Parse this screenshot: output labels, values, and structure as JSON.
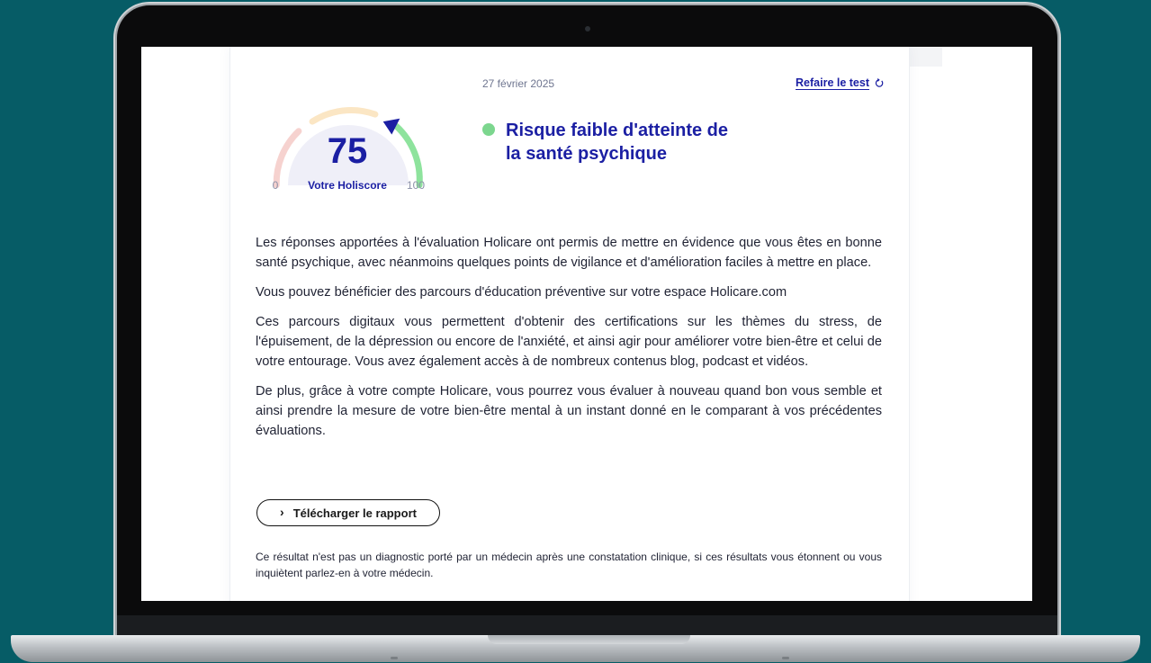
{
  "report": {
    "date": "27 février 2025",
    "retake_label": "Refaire le test",
    "score": "75",
    "score_label": "Votre Holiscore",
    "scale_min": "0",
    "scale_max": "100",
    "score_fraction": 0.75,
    "risk_title": "Risque faible d'atteinte de la santé psychique",
    "paragraphs": [
      "Les réponses apportées à l'évaluation Holicare ont permis de mettre en évidence que vous êtes en bonne santé psychique, avec néanmoins quelques points de vigilance et d'amélioration faciles à mettre en place.",
      "Vous pouvez bénéficier des parcours d'éducation préventive sur votre espace Holicare.com",
      "Ces parcours digitaux vous permettent d'obtenir des certifications sur les thèmes du stress, de l'épuisement, de la dépression ou encore de l'anxiété, et ainsi agir pour améliorer votre bien-être et celui de votre entourage. Vous avez également accès à de nombreux contenus blog, podcast et vidéos.",
      "De plus, grâce à votre compte Holicare, vous pourrez vous évaluer à nouveau quand bon vous semble et ainsi prendre la mesure de votre bien-être mental à un instant donné en le comparant à vos précédentes évaluations."
    ],
    "download_label": "Télécharger le rapport",
    "disclaimer": "Ce résultat n'est pas un diagnostic porté par un médecin après une constatation clinique, si ces résultats vous étonnent ou vous inquiètent parlez-en à votre médecin."
  },
  "colors": {
    "accent": "#1b1fa3",
    "risk_low": "#7cd68e",
    "gauge_red": "#f6d2cf",
    "gauge_yellow": "#fbe6c4",
    "gauge_green": "#8ee39d",
    "gauge_inner": "#efeff8",
    "background": "#065c66"
  },
  "icons": {
    "retake": "refresh-icon",
    "download": "chevron-right-icon"
  }
}
